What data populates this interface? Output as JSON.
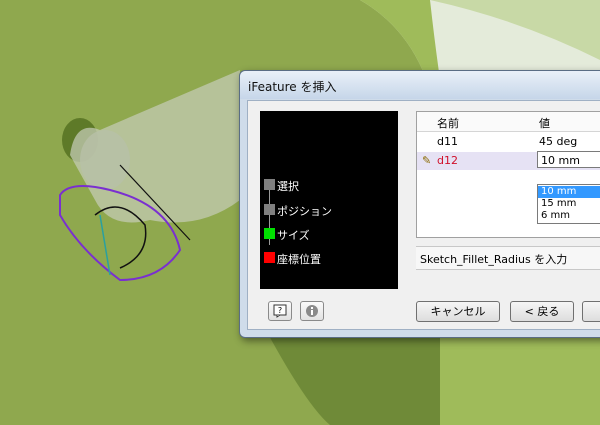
{
  "dialog": {
    "title": "iFeature を挿入",
    "steps": [
      {
        "label": "選択",
        "color": "#7f7f7f"
      },
      {
        "label": "ポジション",
        "color": "#7f7f7f"
      },
      {
        "label": "サイズ",
        "color": "#00e000"
      },
      {
        "label": "座標位置",
        "color": "#ff0000"
      }
    ],
    "table": {
      "headers": [
        "名前",
        "値"
      ],
      "rows": [
        {
          "name": "d11",
          "value": "45 deg"
        },
        {
          "name": "d12",
          "value": "10 mm"
        }
      ],
      "dropdown_options": [
        "10 mm",
        "15 mm",
        "6 mm"
      ],
      "dropdown_selected": "10 mm"
    },
    "prompt": "Sketch_Fillet_Radius を入力",
    "buttons": {
      "cancel": "キャンセル",
      "back": "< 戻る"
    },
    "icons": {
      "help": "help-icon",
      "info": "info-icon",
      "edit": "pencil-icon"
    }
  },
  "colors": {
    "model_green": "#8fa84e",
    "background": "#e4ebda",
    "sketch_purple": "#7a2fd0",
    "step_size": "#00e000",
    "step_position": "#ff0000"
  }
}
